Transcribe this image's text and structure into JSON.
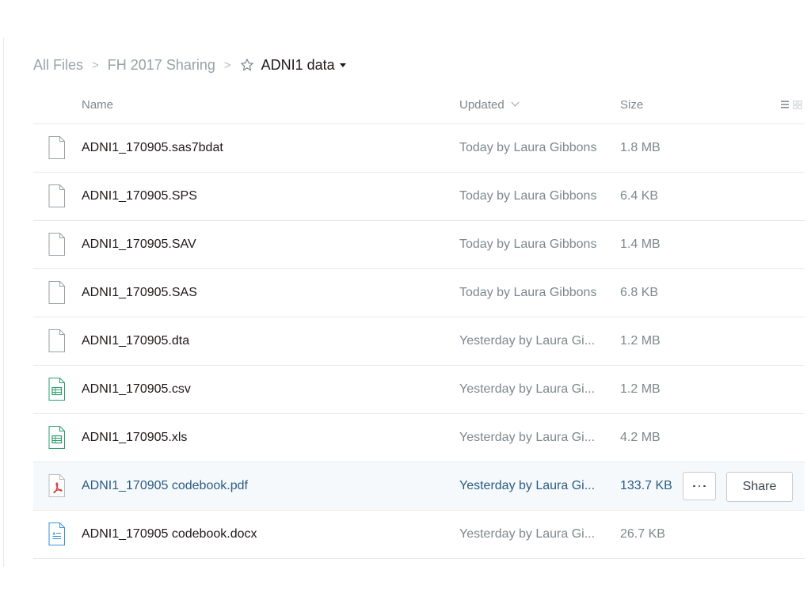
{
  "breadcrumb": {
    "items": [
      "All Files",
      "FH 2017 Sharing"
    ],
    "separator": ">",
    "current": "ADNI1 data"
  },
  "columns": {
    "name": "Name",
    "updated": "Updated",
    "size": "Size"
  },
  "files": [
    {
      "name": "ADNI1_170905.sas7bdat",
      "updated": "Today by Laura Gibbons",
      "size": "1.8 MB",
      "icon": "file-icon"
    },
    {
      "name": "ADNI1_170905.SPS",
      "updated": "Today by Laura Gibbons",
      "size": "6.4 KB",
      "icon": "file-icon"
    },
    {
      "name": "ADNI1_170905.SAV",
      "updated": "Today by Laura Gibbons",
      "size": "1.4 MB",
      "icon": "file-icon"
    },
    {
      "name": "ADNI1_170905.SAS",
      "updated": "Today by Laura Gibbons",
      "size": "6.8 KB",
      "icon": "file-icon"
    },
    {
      "name": "ADNI1_170905.dta",
      "updated": "Yesterday by Laura Gi...",
      "size": "1.2 MB",
      "icon": "file-icon"
    },
    {
      "name": "ADNI1_170905.csv",
      "updated": "Yesterday by Laura Gi...",
      "size": "1.2 MB",
      "icon": "spreadsheet-icon"
    },
    {
      "name": "ADNI1_170905.xls",
      "updated": "Yesterday by Laura Gi...",
      "size": "4.2 MB",
      "icon": "spreadsheet-icon"
    },
    {
      "name": "ADNI1_170905 codebook.pdf",
      "updated": "Yesterday by Laura Gi...",
      "size": "133.7 KB",
      "icon": "pdf-icon"
    },
    {
      "name": "ADNI1_170905 codebook.docx",
      "updated": "Yesterday by Laura Gi...",
      "size": "26.7 KB",
      "icon": "document-icon"
    }
  ],
  "selected_row": {
    "more_label": "···",
    "share_label": "Share"
  },
  "colors": {
    "spreadsheet": "#2e9e6c",
    "pdf": "#e0363d",
    "document": "#3b8fd6",
    "selected_text": "#2a5b83"
  }
}
